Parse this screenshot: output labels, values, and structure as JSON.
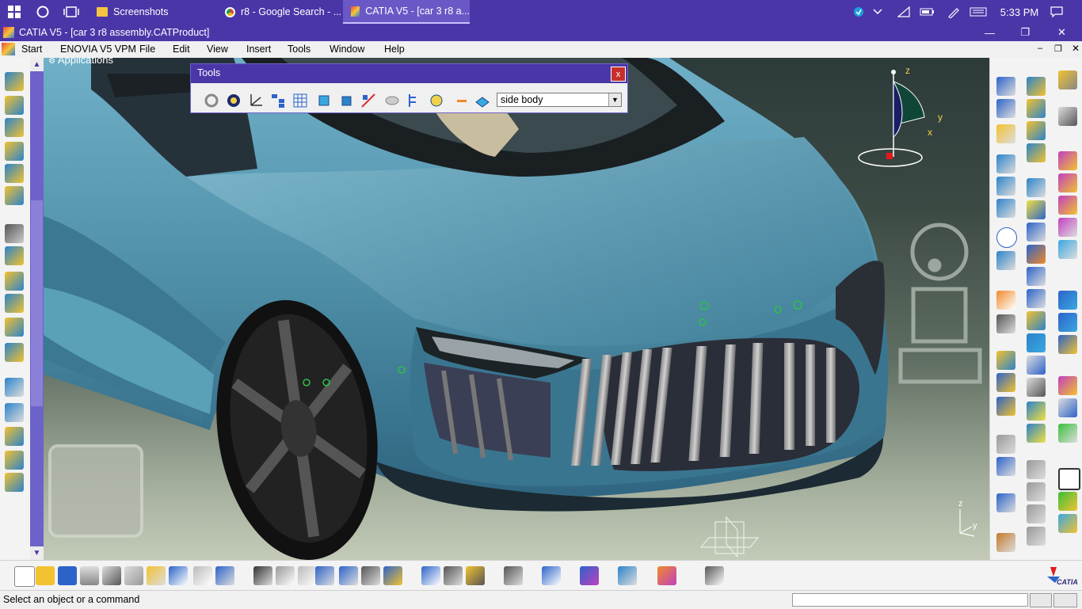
{
  "taskbar": {
    "tasks": [
      {
        "label": "Screenshots",
        "icon": "folder-icon"
      },
      {
        "label": "r8 - Google Search - ...",
        "icon": "chrome-icon"
      },
      {
        "label": "CATIA V5 - [car 3 r8 a...",
        "icon": "catia-icon"
      }
    ],
    "clock": "5:33 PM"
  },
  "window": {
    "title": "CATIA V5 - [car 3 r8 assembly.CATProduct]"
  },
  "menu": {
    "items": [
      "Start",
      "ENOVIA V5 VPM",
      "File",
      "Edit",
      "View",
      "Insert",
      "Tools",
      "Window",
      "Help"
    ]
  },
  "tree": {
    "root_label": "Applications"
  },
  "tools_panel": {
    "title": "Tools",
    "close_label": "x",
    "layer_value": "side body"
  },
  "compass": {
    "axis_x": "x",
    "axis_y": "y",
    "axis_z": "z"
  },
  "triad": {
    "axis_z": "z",
    "axis_y": "y"
  },
  "status": {
    "message": "Select an object or a command"
  },
  "brand": {
    "logo_text": "CATIA"
  },
  "colors": {
    "titlebar": "#4b36a8",
    "car_body": "#4f8fa8",
    "background": "#3c4a44"
  }
}
